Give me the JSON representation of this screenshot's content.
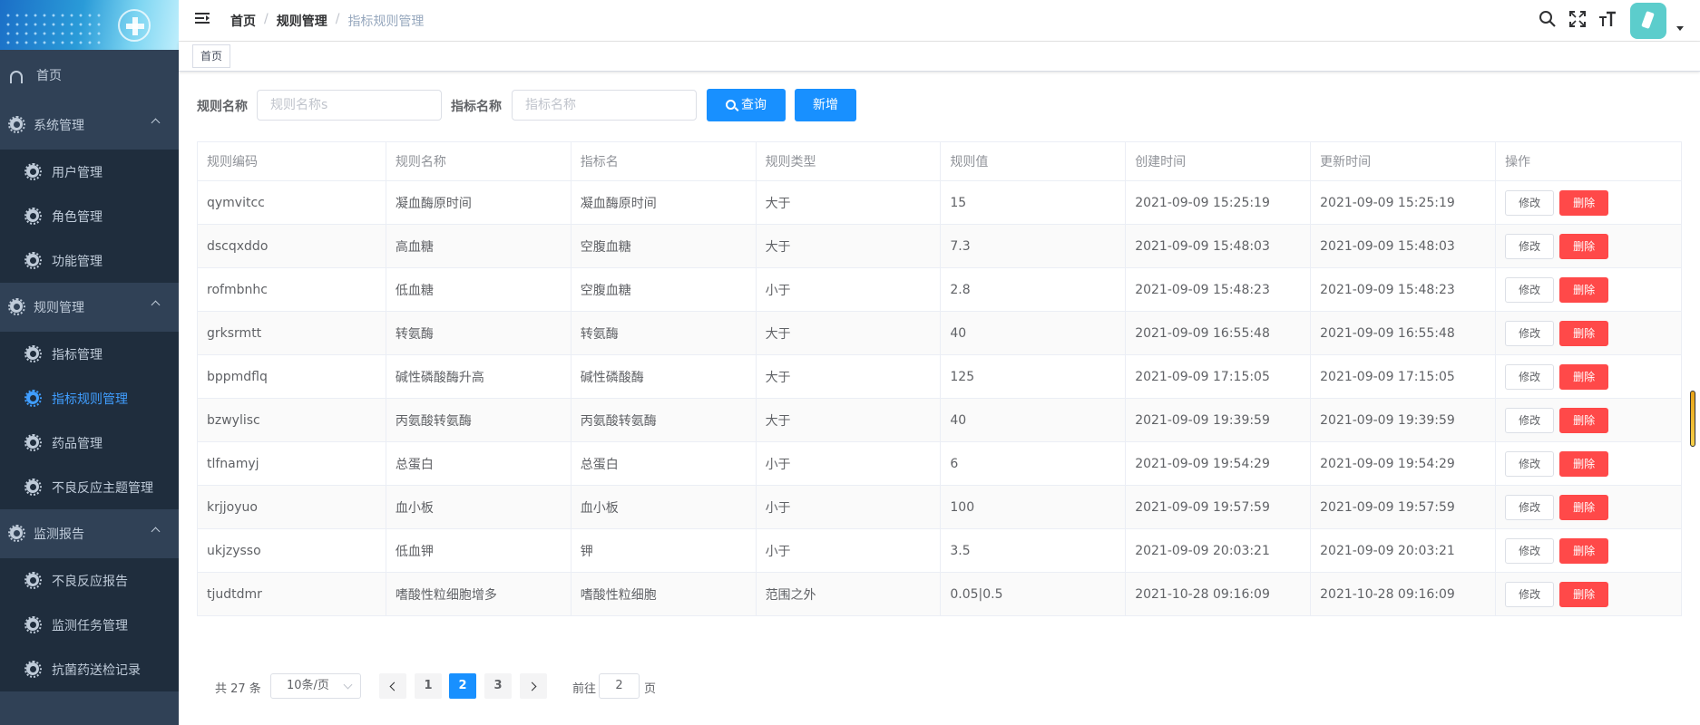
{
  "sidebar": {
    "items": [
      {
        "label": "首页",
        "icon": "dashboard-icon",
        "level": 0
      },
      {
        "label": "系统管理",
        "icon": "gear-icon",
        "level": 0,
        "expanded": true
      },
      {
        "label": "用户管理",
        "icon": "gear-icon",
        "level": 1
      },
      {
        "label": "角色管理",
        "icon": "gear-icon",
        "level": 1
      },
      {
        "label": "功能管理",
        "icon": "gear-icon",
        "level": 1
      },
      {
        "label": "规则管理",
        "icon": "gear-icon",
        "level": 0,
        "expanded": true
      },
      {
        "label": "指标管理",
        "icon": "gear-icon",
        "level": 1
      },
      {
        "label": "指标规则管理",
        "icon": "gear-icon",
        "level": 1,
        "active": true
      },
      {
        "label": "药品管理",
        "icon": "gear-icon",
        "level": 1
      },
      {
        "label": "不良反应主题管理",
        "icon": "gear-icon",
        "level": 1
      },
      {
        "label": "监测报告",
        "icon": "gear-icon",
        "level": 0,
        "expanded": true
      },
      {
        "label": "不良反应报告",
        "icon": "gear-icon",
        "level": 1
      },
      {
        "label": "监测任务管理",
        "icon": "gear-icon",
        "level": 1
      },
      {
        "label": "抗菌药送检记录",
        "icon": "gear-icon",
        "level": 1
      }
    ]
  },
  "navbar": {
    "breadcrumb": [
      "首页",
      "规则管理",
      "指标规则管理"
    ],
    "icons": [
      "search-icon",
      "fullscreen-icon",
      "font-size-icon"
    ]
  },
  "tags": [
    "首页"
  ],
  "search": {
    "rule_name_label": "规则名称",
    "rule_name_placeholder": "规则名称s",
    "indicator_name_label": "指标名称",
    "indicator_name_placeholder": "指标名称",
    "query_button": "查询",
    "add_button": "新增"
  },
  "table": {
    "columns": [
      "规则编码",
      "规则名称",
      "指标名",
      "规则类型",
      "规则值",
      "创建时间",
      "更新时间",
      "操作"
    ],
    "edit_label": "修改",
    "delete_label": "删除",
    "rows": [
      [
        "qymvitcc",
        "凝血酶原时间",
        "凝血酶原时间",
        "大于",
        "15",
        "2021-09-09 15:25:19",
        "2021-09-09 15:25:19"
      ],
      [
        "dscqxddo",
        "高血糖",
        "空腹血糖",
        "大于",
        "7.3",
        "2021-09-09 15:48:03",
        "2021-09-09 15:48:03"
      ],
      [
        "rofmbnhc",
        "低血糖",
        "空腹血糖",
        "小于",
        "2.8",
        "2021-09-09 15:48:23",
        "2021-09-09 15:48:23"
      ],
      [
        "grksrmtt",
        "转氨酶",
        "转氨酶",
        "大于",
        "40",
        "2021-09-09 16:55:48",
        "2021-09-09 16:55:48"
      ],
      [
        "bppmdflq",
        "碱性磷酸酶升高",
        "碱性磷酸酶",
        "大于",
        "125",
        "2021-09-09 17:15:05",
        "2021-09-09 17:15:05"
      ],
      [
        "bzwylisc",
        "丙氨酸转氨酶",
        "丙氨酸转氨酶",
        "大于",
        "40",
        "2021-09-09 19:39:59",
        "2021-09-09 19:39:59"
      ],
      [
        "tlfnamyj",
        "总蛋白",
        "总蛋白",
        "小于",
        "6",
        "2021-09-09 19:54:29",
        "2021-09-09 19:54:29"
      ],
      [
        "krjjoyuo",
        "血小板",
        "血小板",
        "小于",
        "100",
        "2021-09-09 19:57:59",
        "2021-09-09 19:57:59"
      ],
      [
        "ukjzysso",
        "低血钾",
        "钾",
        "小于",
        "3.5",
        "2021-09-09 20:03:21",
        "2021-09-09 20:03:21"
      ],
      [
        "tjudtdmr",
        "嗜酸性粒细胞增多",
        "嗜酸性粒细胞",
        "范围之外",
        "0.05|0.5",
        "2021-10-28 09:16:09",
        "2021-10-28 09:16:09"
      ]
    ]
  },
  "pagination": {
    "total_text": "共 27 条",
    "page_size": "10条/页",
    "pages": [
      "1",
      "2",
      "3"
    ],
    "current": "2",
    "goto_label": "前往",
    "goto_value": "2",
    "goto_suffix": "页"
  },
  "colors": {
    "sidebar_bg": "#304156",
    "submenu_bg": "#1f2d3d",
    "primary": "#1890ff",
    "danger": "#ff4949",
    "active_menu": "#409eff"
  }
}
